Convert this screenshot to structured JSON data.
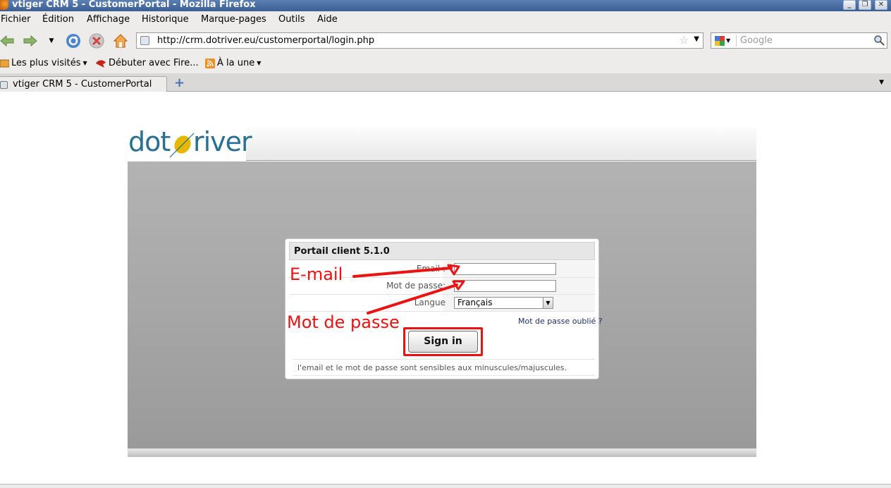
{
  "window": {
    "title": "vtiger CRM 5 - CustomerPortal - Mozilla Firefox"
  },
  "menu": {
    "items": [
      "Fichier",
      "Édition",
      "Affichage",
      "Historique",
      "Marque-pages",
      "Outils",
      "Aide"
    ]
  },
  "navigation": {
    "url": "http://crm.dotriver.eu/customerportal/login.php",
    "search_placeholder": "Google"
  },
  "bookmarks": {
    "items": [
      "Les plus visités",
      "Débuter avec Fire...",
      "À la une"
    ]
  },
  "tabs": [
    {
      "label": "vtiger CRM 5 - CustomerPortal",
      "active": true
    }
  ],
  "page": {
    "logo_left": "dot",
    "logo_right": "river",
    "panel": {
      "title": "Portail client 5.1.0",
      "email_label": "Email :",
      "password_label": "Mot de passe:",
      "language_label": "Langue",
      "language_value": "Français",
      "forgot_link": "Mot de passe oublié ?",
      "signin_label": "Sign in",
      "note": "l'email et le mot de passe sont sensibles aux minuscules/majuscules."
    },
    "annotations": {
      "email": "E-mail",
      "password": "Mot de passe",
      "color": "#ee1111"
    }
  },
  "colors": {
    "titlebar": "#3b5e93",
    "chrome": "#edeceb",
    "logo_blue": "#2a6f94",
    "logo_yellow": "#e6b800",
    "content_gray": "#a7a7a7"
  }
}
